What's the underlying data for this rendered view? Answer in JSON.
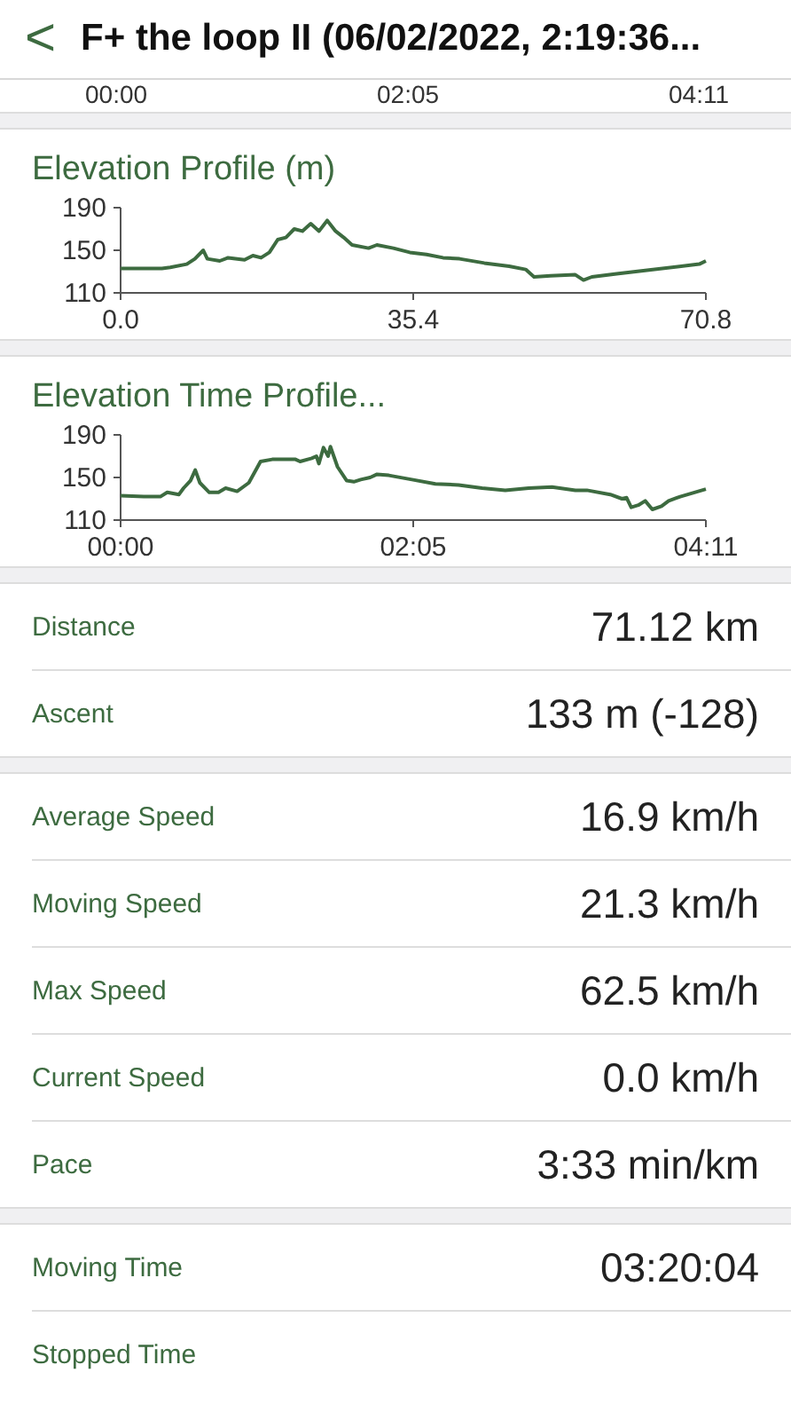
{
  "header": {
    "back": "<",
    "title": "F+ the loop II (06/02/2022, 2:19:36..."
  },
  "previous_chart_axis": [
    "00:00",
    "02:05",
    "04:11"
  ],
  "charts": [
    {
      "title": "Elevation Profile (m)",
      "chart_data": {
        "type": "line",
        "x": [
          0,
          5,
          6,
          8,
          9,
          10,
          10.5,
          12,
          13,
          15,
          16,
          17,
          18,
          19,
          20,
          21,
          22,
          23,
          24,
          25,
          26,
          27,
          28,
          30,
          31,
          33,
          35,
          37,
          39,
          41,
          44,
          47,
          49,
          50,
          52,
          55,
          56,
          57,
          60,
          70,
          70.8
        ],
        "series": [
          {
            "color": "#3d6b40",
            "values": [
              133,
              133,
              134,
              137,
              142,
              150,
              142,
              140,
              143,
              141,
              145,
              143,
              148,
              160,
              162,
              170,
              168,
              175,
              168,
              178,
              168,
              162,
              155,
              152,
              155,
              152,
              148,
              146,
              143,
              142,
              138,
              135,
              132,
              125,
              126,
              127,
              122,
              125,
              128,
              137,
              140
            ]
          }
        ],
        "xlim": [
          0,
          70.8
        ],
        "ylim": [
          110,
          190
        ],
        "xticks": [
          {
            "value": 0,
            "label": "0.0"
          },
          {
            "value": 35.4,
            "label": "35.4"
          },
          {
            "value": 70.8,
            "label": "70.8"
          }
        ],
        "yticks": [
          110,
          150,
          190
        ]
      }
    },
    {
      "title": "Elevation Time Profile...",
      "chart_data": {
        "type": "line",
        "x": [
          0,
          10,
          17,
          20,
          25,
          27,
          30,
          32,
          34,
          38,
          42,
          45,
          50,
          55,
          60,
          65,
          75,
          77,
          82,
          84,
          85,
          87,
          89,
          90,
          93,
          97,
          100,
          103,
          107,
          110,
          115,
          125,
          135,
          145,
          155,
          165,
          175,
          185,
          195,
          200,
          210,
          215,
          217,
          219,
          222,
          225,
          228,
          232,
          235,
          240,
          251
        ],
        "series": [
          {
            "color": "#3d6b40",
            "values": [
              133,
              132,
              132,
              136,
              134,
              140,
              147,
              157,
              145,
              136,
              136,
              140,
              137,
              145,
              165,
              167,
              167,
              165,
              168,
              170,
              163,
              178,
              170,
              179,
              160,
              147,
              146,
              148,
              150,
              153,
              152,
              148,
              144,
              143,
              140,
              138,
              140,
              141,
              138,
              138,
              134,
              130,
              131,
              122,
              124,
              128,
              120,
              123,
              128,
              132,
              139
            ]
          }
        ],
        "xlim": [
          0,
          251
        ],
        "ylim": [
          110,
          190
        ],
        "xticks": [
          {
            "value": 0,
            "label": "00:00"
          },
          {
            "value": 125.5,
            "label": "02:05"
          },
          {
            "value": 251,
            "label": "04:11"
          }
        ],
        "yticks": [
          110,
          150,
          190
        ]
      }
    }
  ],
  "stat_groups": [
    [
      {
        "label": "Distance",
        "value": "71.12 km"
      },
      {
        "label": "Ascent",
        "value": "133 m (-128)"
      }
    ],
    [
      {
        "label": "Average Speed",
        "value": "16.9 km/h"
      },
      {
        "label": "Moving Speed",
        "value": "21.3 km/h"
      },
      {
        "label": "Max Speed",
        "value": "62.5 km/h"
      },
      {
        "label": "Current Speed",
        "value": "0.0 km/h"
      },
      {
        "label": "Pace",
        "value": "3:33 min/km"
      }
    ],
    [
      {
        "label": "Moving Time",
        "value": "03:20:04"
      },
      {
        "label": "Stopped Time"
      }
    ]
  ]
}
